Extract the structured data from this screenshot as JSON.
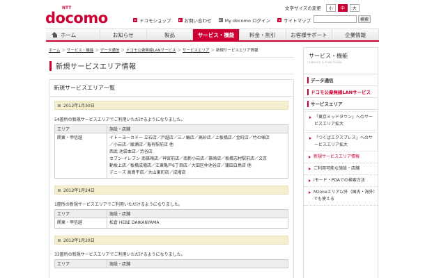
{
  "header": {
    "logo_ntt": "NTT",
    "logo_text": "docomo",
    "font_size_label": "文字サイズの変更",
    "font_sizes": [
      "小",
      "中",
      "大"
    ],
    "utility_links": [
      "ドコモショップ",
      "お問い合わせ",
      "My docomo ログイン",
      "サイトマップ"
    ],
    "search_button": "検索"
  },
  "nav": {
    "tabs": [
      "ホーム",
      "お知らせ",
      "製品",
      "サービス・機能",
      "料金・割引",
      "お客様サポート",
      "企業情報"
    ],
    "active": "サービス・機能"
  },
  "breadcrumb": [
    "ホーム",
    "サービス・機能",
    "データ通信",
    "ドコモ公衆無線LANサービス",
    "サービスエリア",
    "新規サービスエリア情報"
  ],
  "page_title": "新規サービスエリア情報",
  "main": {
    "section_title": "新規サービスエリア一覧",
    "col_area": "エリア",
    "col_facility": "施設・店舗",
    "entries": [
      {
        "date": "2012年1月30日",
        "message": "54箇所の新規サービスエリアでご利用いただけるようになりました。",
        "area": "関東・甲信越",
        "facilities": [
          "イトーヨーカドー 立石店／戸越店／三ノ輪店／高砂店／上板橋店／金町店／竹の塚店",
          "／小岩店／綾瀬店／亀有駅前店 他",
          "西武 池袋本店／渋谷店",
          "セブン-イレブン 南篠崎店／神宮前店／南新小岩店／篠崎店／板橋志村駅前店／文京",
          "動坂上店／板橋成増店／江東亀戸6丁目店／大田区仲池谷店／蒲田白鳥店 他",
          "デニーズ 高島平店／大山東町店／成増店"
        ]
      },
      {
        "date": "2012年1月24日",
        "message": "1箇所の新規サービスエリアでご利用いただけるようになりました。",
        "area": "関東・甲信越",
        "facilities": [
          "松倉 HEBE DAIKANYAMA"
        ]
      },
      {
        "date": "2012年1月20日",
        "message": "33箇所の新規サービスエリアでご利用いただけるようになりました。"
      }
    ]
  },
  "sidebar": {
    "title": "サービス・機能",
    "title_en": "SERVICE & FUNCTIONS",
    "cat1": "データ通信",
    "cat2": "ドコモ公衆無線LANサービス",
    "cat3": "サービスエリア",
    "items": [
      "「東京ミッドタウン」へのサービスエリア拡大",
      "「つくばエクスプレス」へのサービスエリア拡大",
      "新規サービスエリア情報",
      "ご利用可能な施設・店舗",
      "iモード・PDAでの検索方法",
      "Mzoneエリア以外（国内・海外）でも使える"
    ]
  },
  "colors": {
    "brand": "#cc0033",
    "date_bar": "#f5efcf"
  }
}
